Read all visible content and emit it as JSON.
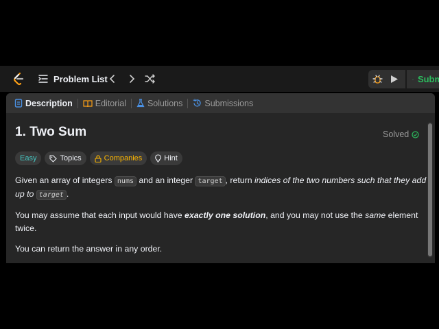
{
  "topbar": {
    "problem_list_label": "Problem List",
    "submit_label": "Submit"
  },
  "tabs": [
    {
      "label": "Description",
      "icon": "document-icon"
    },
    {
      "label": "Editorial",
      "icon": "book-icon"
    },
    {
      "label": "Solutions",
      "icon": "flask-icon"
    },
    {
      "label": "Submissions",
      "icon": "history-icon"
    }
  ],
  "problem": {
    "title": "1. Two Sum",
    "status": "Solved",
    "chips": {
      "difficulty": "Easy",
      "topics": "Topics",
      "companies": "Companies",
      "hint": "Hint"
    },
    "p1": {
      "a": "Given an array of integers ",
      "code1": "nums",
      "b": " and an integer ",
      "code2": "target",
      "c": ", return ",
      "em": "indices of the two numbers such that they add up to",
      "d": " ",
      "code3": "target",
      "e": "."
    },
    "p2": {
      "a": "You may assume that each input would have ",
      "strong": "exactly one solution",
      "b": ", and you may not use the ",
      "em": "same",
      "c": " element twice."
    },
    "p3": "You can return the answer in any order."
  },
  "colors": {
    "easy": "#46c6c2",
    "companies": "#ffb800",
    "submit": "#2cbb5d",
    "description_tab_icon": "#4a90e2"
  }
}
